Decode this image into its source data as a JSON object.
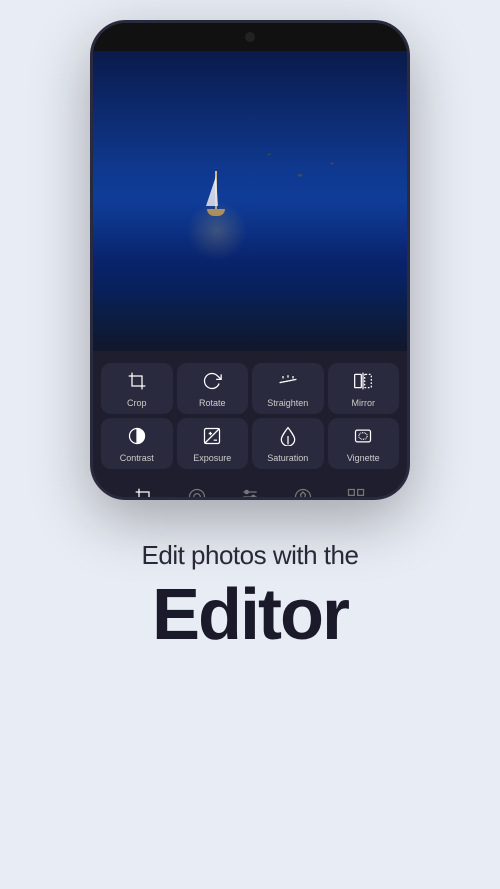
{
  "app": {
    "background_color": "#e8ecf4"
  },
  "phone": {
    "frame_color": "#1a1a2e"
  },
  "editor": {
    "panel_color": "#1e1e2e",
    "tools": [
      {
        "id": "crop",
        "label": "Crop",
        "icon": "crop"
      },
      {
        "id": "rotate",
        "label": "Rotate",
        "icon": "rotate"
      },
      {
        "id": "straighten",
        "label": "Straighten",
        "icon": "straighten"
      },
      {
        "id": "mirror",
        "label": "Mirror",
        "icon": "mirror"
      },
      {
        "id": "contrast",
        "label": "Contrast",
        "icon": "contrast"
      },
      {
        "id": "exposure",
        "label": "Exposure",
        "icon": "exposure"
      },
      {
        "id": "saturation",
        "label": "Saturation",
        "icon": "saturation"
      },
      {
        "id": "vignette",
        "label": "Vignette",
        "icon": "vignette"
      }
    ],
    "bottom_toolbar": [
      {
        "id": "crop-tab",
        "icon": "crop-small",
        "active": true
      },
      {
        "id": "filter-tab",
        "icon": "filter",
        "active": false
      },
      {
        "id": "adjust-tab",
        "icon": "adjust",
        "active": false
      },
      {
        "id": "paint-tab",
        "icon": "paint",
        "active": false
      },
      {
        "id": "grid-tab",
        "icon": "grid",
        "active": false
      }
    ]
  },
  "text": {
    "subtitle": "Edit photos with the",
    "main_title": "Editor"
  }
}
